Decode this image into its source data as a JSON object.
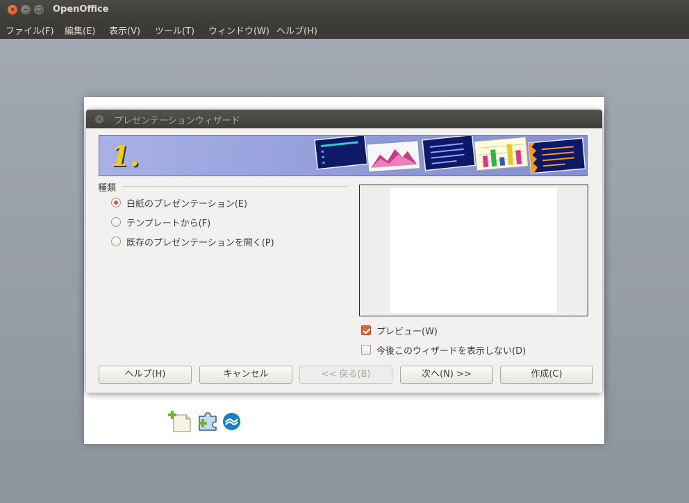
{
  "window": {
    "title": "OpenOffice",
    "close_glyph": "×",
    "min_glyph": "–",
    "max_glyph": "□"
  },
  "menu": {
    "items": [
      "ファイル(F)",
      "編集(E)",
      "表示(V)",
      "ツール(T)",
      "ウィンドウ(W)",
      "ヘルプ(H)"
    ]
  },
  "dialog": {
    "title": "プレゼンテーションウィザード",
    "close_glyph": "×",
    "banner_step": "1.",
    "section_label": "種類",
    "radios": [
      {
        "label": "白紙のプレゼンテーション(E)",
        "checked": true
      },
      {
        "label": "テンプレートから(F)",
        "checked": false
      },
      {
        "label": "既存のプレゼンテーションを開く(P)",
        "checked": false
      }
    ],
    "checks": [
      {
        "label": "プレビュー(W)",
        "checked": true
      },
      {
        "label": "今後このウィザードを表示しない(D)",
        "checked": false
      }
    ],
    "buttons": {
      "help": "ヘルプ(H)",
      "cancel": "キャンセル",
      "back": "<< 戻る(B)",
      "next": "次へ(N) >>",
      "create": "作成(C)"
    }
  },
  "icons": {
    "new_document": "new-document-icon",
    "extension": "extension-icon",
    "openoffice_logo": "openoffice-logo-icon"
  },
  "colors": {
    "accent": "#e05a2b",
    "banner": "#8e98d6",
    "titlebar": "#3c3b37"
  }
}
